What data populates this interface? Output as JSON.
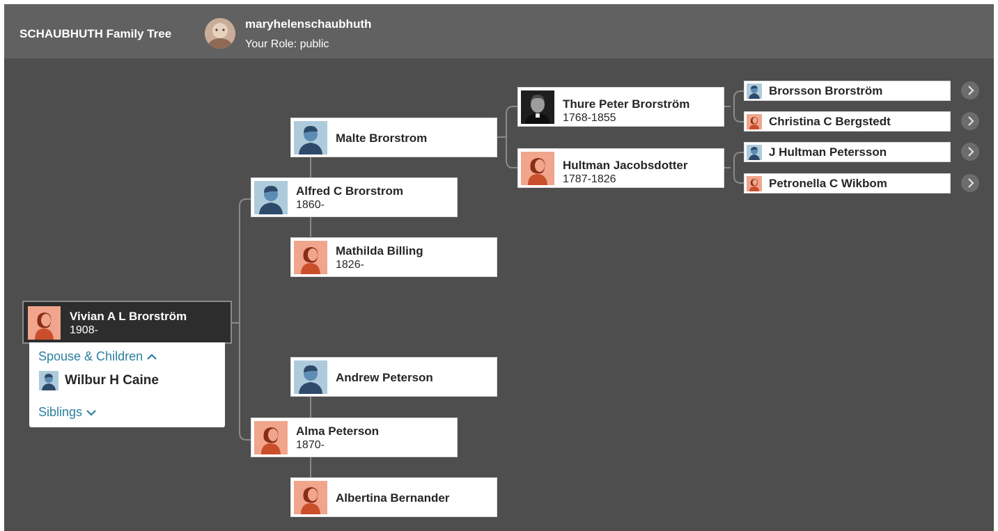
{
  "header": {
    "tree_title": "SCHAUBHUTH Family Tree",
    "username": "maryhelenschaubhuth",
    "role": "Your Role: public"
  },
  "focus_person": {
    "name": "Vivian A L Brorström",
    "years": "1908-",
    "gender": "female"
  },
  "popup": {
    "spouse_children_label": "Spouse & Children",
    "spouse_name": "Wilbur H Caine",
    "siblings_label": "Siblings"
  },
  "parents": {
    "father": {
      "name": "Alfred C Brorstrom",
      "years": "1860-"
    },
    "mother": {
      "name": "Alma Peterson",
      "years": "1870-"
    }
  },
  "grandparents": {
    "paternal_grandfather": {
      "name": "Malte Brorstrom"
    },
    "paternal_grandmother": {
      "name": "Mathilda Billing",
      "years": "1826-"
    },
    "maternal_grandfather": {
      "name": "Andrew Peterson"
    },
    "maternal_grandmother": {
      "name": "Albertina Bernander"
    }
  },
  "great_grandparents": {
    "father": {
      "name": "Thure Peter Brorström",
      "years": "1768-1855"
    },
    "mother": {
      "name": "Hultman Jacobsdotter",
      "years": "1787-1826"
    }
  },
  "great_great_grandparents": [
    {
      "name": "Brorsson Brorström",
      "gender": "male"
    },
    {
      "name": "Christina C Bergstedt",
      "gender": "female"
    },
    {
      "name": "J Hultman Petersson",
      "gender": "male"
    },
    {
      "name": "Petronella C Wikbom",
      "gender": "female"
    }
  ],
  "icons": {
    "expand": "chevron-right-icon",
    "collapse_spouse": "chevron-up-icon",
    "expand_siblings": "chevron-down-icon",
    "male_avatar": "male-silhouette-icon",
    "female_avatar": "female-silhouette-icon"
  },
  "colors": {
    "background": "#4e4e4e",
    "header": "#616161",
    "link": "#2a7f9e",
    "male_avatar_bg": "#aecbdc",
    "female_avatar_bg": "#f0a58c"
  }
}
